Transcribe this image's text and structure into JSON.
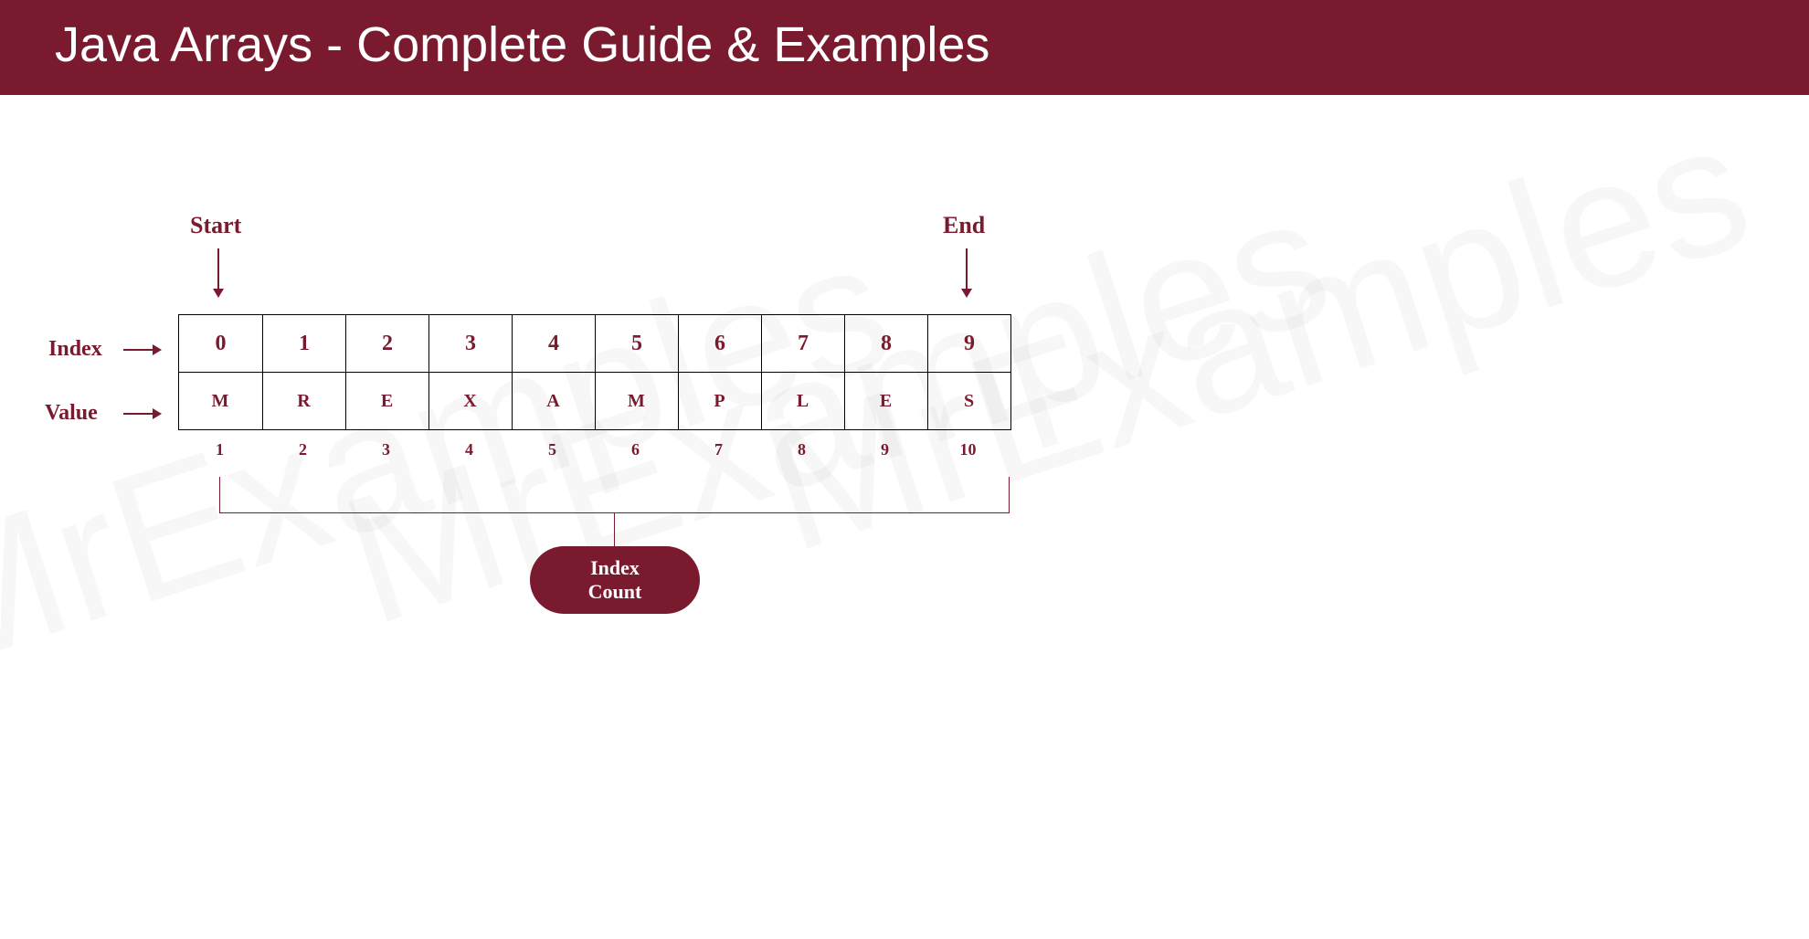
{
  "header": {
    "title": "Java Arrays - Complete Guide & Examples"
  },
  "labels": {
    "start": "Start",
    "end": "End",
    "index": "Index",
    "value": "Value",
    "pill_line1": "Index",
    "pill_line2": "Count"
  },
  "array": {
    "indices": [
      "0",
      "1",
      "2",
      "3",
      "4",
      "5",
      "6",
      "7",
      "8",
      "9"
    ],
    "values": [
      "M",
      "R",
      "E",
      "X",
      "A",
      "M",
      "P",
      "L",
      "E",
      "S"
    ],
    "counts": [
      "1",
      "2",
      "3",
      "4",
      "5",
      "6",
      "7",
      "8",
      "9",
      "10"
    ]
  },
  "watermark": "MrExamples",
  "colors": {
    "brand": "#7a1a2e"
  }
}
